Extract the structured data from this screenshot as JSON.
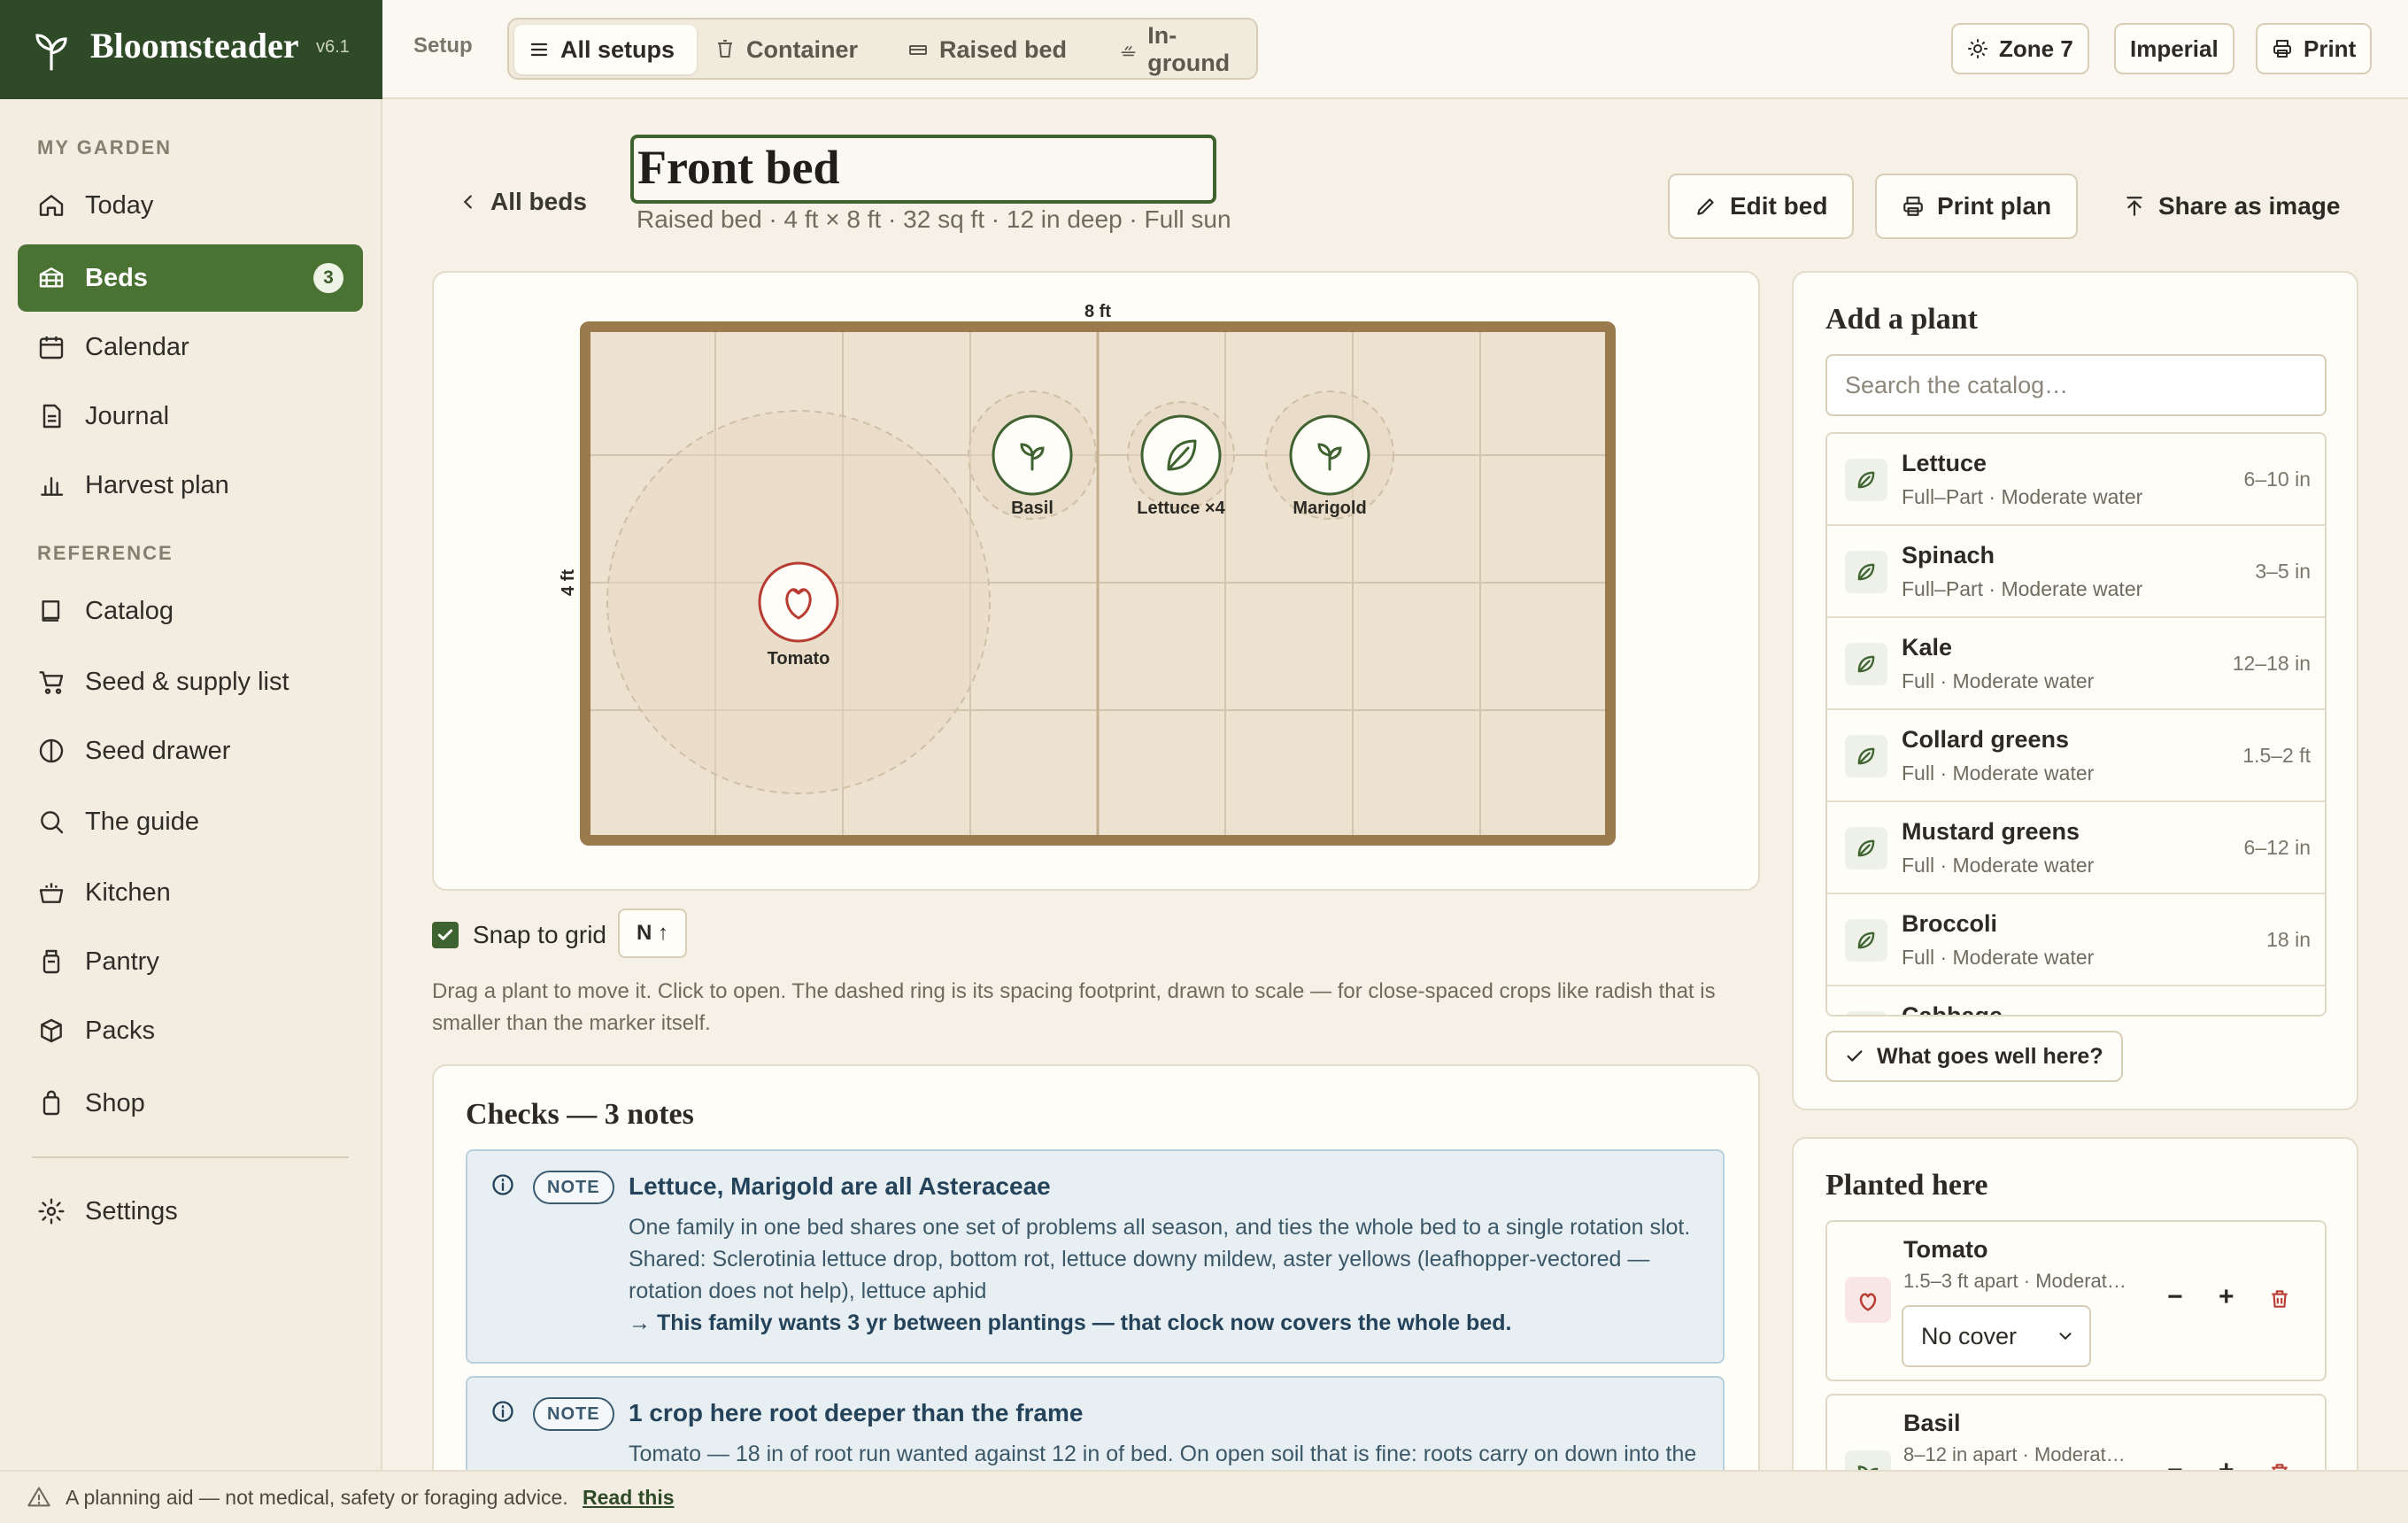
{
  "app": {
    "name": "Bloomsteader",
    "version": "v6.1"
  },
  "topbar": {
    "setup_label": "Setup",
    "tabs": [
      {
        "label": "All setups",
        "icon": "list-icon"
      },
      {
        "label": "Container",
        "icon": "bucket-icon"
      },
      {
        "label": "Raised bed",
        "icon": "raised-bed-icon"
      },
      {
        "label": "In-ground",
        "icon": "ground-icon"
      }
    ],
    "zone": "Zone 7",
    "units": "Imperial",
    "print": "Print"
  },
  "sidebar": {
    "section1": "MY GARDEN",
    "section2": "REFERENCE",
    "items": [
      {
        "label": "Today",
        "icon": "home-icon"
      },
      {
        "label": "Beds",
        "icon": "bed-icon",
        "badge": "3"
      },
      {
        "label": "Calendar",
        "icon": "calendar-icon"
      },
      {
        "label": "Journal",
        "icon": "journal-icon"
      },
      {
        "label": "Harvest plan",
        "icon": "bar-chart-icon"
      },
      {
        "label": "Catalog",
        "icon": "book-icon"
      },
      {
        "label": "Seed & supply list",
        "icon": "cart-icon"
      },
      {
        "label": "Seed drawer",
        "icon": "seed-icon"
      },
      {
        "label": "The guide",
        "icon": "search-icon"
      },
      {
        "label": "Kitchen",
        "icon": "pot-icon"
      },
      {
        "label": "Pantry",
        "icon": "jar-icon"
      },
      {
        "label": "Packs",
        "icon": "box-icon"
      },
      {
        "label": "Shop",
        "icon": "bag-icon"
      },
      {
        "label": "Settings",
        "icon": "gear-icon"
      }
    ]
  },
  "header": {
    "back": "All beds",
    "title": "Front bed",
    "subtitle": "Raised bed · 4 ft × 8 ft · 32 sq ft · 12 in deep · Full sun",
    "edit": "Edit bed",
    "print_plan": "Print plan",
    "share": "Share as image"
  },
  "bed": {
    "width_label": "8 ft",
    "height_label": "4 ft",
    "plants": [
      {
        "label": "Tomato",
        "kind": "tomato"
      },
      {
        "label": "Basil",
        "kind": "basil"
      },
      {
        "label": "Lettuce ×4",
        "kind": "leaf"
      },
      {
        "label": "Marigold",
        "kind": "basil"
      }
    ],
    "colors": {
      "frame": "#9b7a4e",
      "soil": "#ede2cf",
      "plant": "#3f6330",
      "tomato": "#b83c32"
    }
  },
  "controls": {
    "snap": "Snap to grid",
    "snap_checked": true,
    "north": "N ↑",
    "hint": "Drag a plant to move it. Click to open. The dashed ring is its spacing footprint, drawn to scale — for close-spaced crops like radish that is smaller than the marker itself."
  },
  "checks": {
    "title": "Checks — 3 notes",
    "notes": [
      {
        "tag": "NOTE",
        "title": "Lettuce, Marigold are all Asteraceae",
        "body": "One family in one bed shares one set of problems all season, and ties the whole bed to a single rotation slot. Shared: Sclerotinia lettuce drop, bottom rot, lettuce downy mildew, aster yellows (leafhopper-vectored — rotation does not help), lettuce aphid",
        "action": "→ This family wants 3 yr between plantings — that clock now covers the whole bed."
      },
      {
        "tag": "NOTE",
        "title": "1 crop here root deeper than the frame",
        "body": "Tomato — 18 in of root run wanted against 12 in of bed. On open soil that is fine: roots carry on down into the"
      }
    ]
  },
  "add_plant": {
    "title": "Add a plant",
    "placeholder": "Search the catalog…",
    "items": [
      {
        "name": "Lettuce",
        "sub": "Full–Part · Moderate water",
        "spacing": "6–10 in"
      },
      {
        "name": "Spinach",
        "sub": "Full–Part · Moderate water",
        "spacing": "3–5 in"
      },
      {
        "name": "Kale",
        "sub": "Full · Moderate water",
        "spacing": "12–18 in"
      },
      {
        "name": "Collard greens",
        "sub": "Full · Moderate water",
        "spacing": "1.5–2 ft"
      },
      {
        "name": "Mustard greens",
        "sub": "Full · Moderate water",
        "spacing": "6–12 in"
      },
      {
        "name": "Broccoli",
        "sub": "Full · Moderate water",
        "spacing": "18 in"
      },
      {
        "name": "Cabbage",
        "sub": "",
        "spacing": ""
      }
    ],
    "goes_well": "What goes well here?"
  },
  "planted": {
    "title": "Planted here",
    "items": [
      {
        "name": "Tomato",
        "sub": "1.5–3 ft apart · Moderat…",
        "cover": "No cover",
        "minus": "−",
        "plus": "+"
      },
      {
        "name": "Basil",
        "sub": "8–12 in apart · Moderat…",
        "minus": "−",
        "plus": "+"
      }
    ]
  },
  "footer": {
    "text": "A planning aid — not medical, safety or foraging advice.",
    "link": "Read this"
  }
}
